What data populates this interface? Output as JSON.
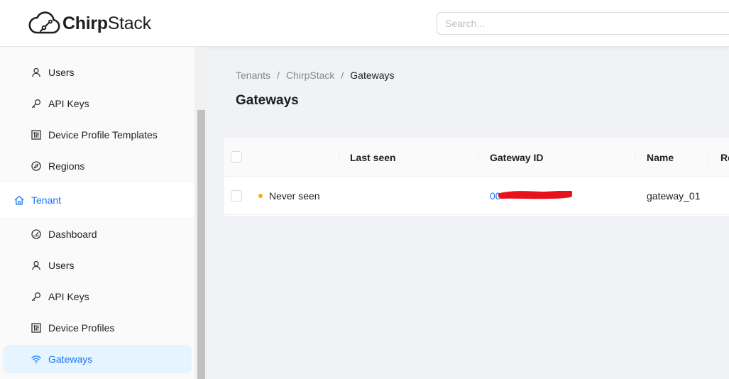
{
  "header": {
    "brand_bold": "Chirp",
    "brand_light": "Stack",
    "search_placeholder": "Search..."
  },
  "sidebar": {
    "items": [
      {
        "label": "Users",
        "icon": "user-icon"
      },
      {
        "label": "API Keys",
        "icon": "key-icon"
      },
      {
        "label": "Device Profile Templates",
        "icon": "sliders-icon"
      },
      {
        "label": "Regions",
        "icon": "compass-icon"
      },
      {
        "label": "Tenant",
        "icon": "home-icon"
      },
      {
        "label": "Dashboard",
        "icon": "dashboard-icon"
      },
      {
        "label": "Users",
        "icon": "user-icon"
      },
      {
        "label": "API Keys",
        "icon": "key-icon"
      },
      {
        "label": "Device Profiles",
        "icon": "sliders-icon"
      },
      {
        "label": "Gateways",
        "icon": "wifi-icon"
      }
    ]
  },
  "breadcrumb": {
    "items": [
      "Tenants",
      "ChirpStack",
      "Gateways"
    ],
    "separator": "/"
  },
  "page": {
    "title": "Gateways"
  },
  "table": {
    "columns": [
      "Last seen",
      "Gateway ID",
      "Name",
      "Re"
    ],
    "rows": [
      {
        "last_seen": "Never seen",
        "status_color": "#faad14",
        "gateway_id_visible": "00",
        "name": "gateway_01"
      }
    ]
  },
  "colors": {
    "accent": "#1677ff",
    "redaction": "#e8121b",
    "status_never_seen": "#faad14"
  }
}
